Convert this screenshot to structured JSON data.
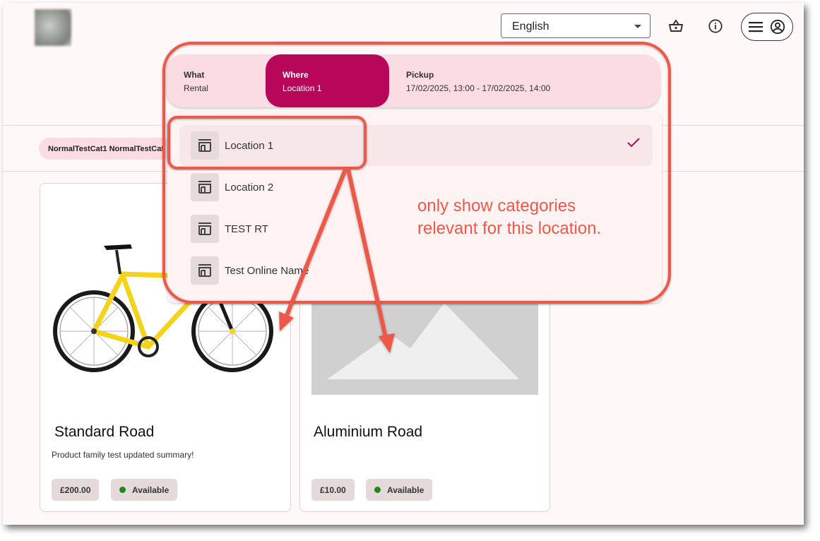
{
  "header": {
    "language": "English",
    "basket_icon": "basket-icon",
    "info_icon": "info-icon",
    "menu_icon": "menu-icon",
    "account_icon": "account-circle-icon"
  },
  "stepper": {
    "steps": [
      {
        "label": "What",
        "value": "Rental"
      },
      {
        "label": "Where",
        "value": "Location 1"
      },
      {
        "label": "Pickup",
        "value": "17/02/2025, 13:00 - 17/02/2025, 14:00"
      }
    ]
  },
  "categories": {
    "chip_text": "NormalTestCat1 NormalTestCat"
  },
  "locations": {
    "icon": "storefront-icon",
    "items": [
      {
        "label": "Location 1",
        "selected": true
      },
      {
        "label": "Location 2",
        "selected": false
      },
      {
        "label": "TEST RT",
        "selected": false
      },
      {
        "label": "Test Online Name",
        "selected": false
      }
    ]
  },
  "annotation": {
    "line1": "only show categories",
    "line2": "relevant for this location."
  },
  "products": [
    {
      "title": "Standard Road",
      "summary": "Product family test updated summary!",
      "price": "£200.00",
      "availability": "Available"
    },
    {
      "title": "Aluminium Road",
      "summary": "",
      "price": "£10.00",
      "availability": "Available"
    }
  ],
  "colors": {
    "accent": "#b8075a",
    "stepper_bg": "#fadce2",
    "annotation": "#ee5848",
    "available_dot": "#1e8a1e"
  }
}
